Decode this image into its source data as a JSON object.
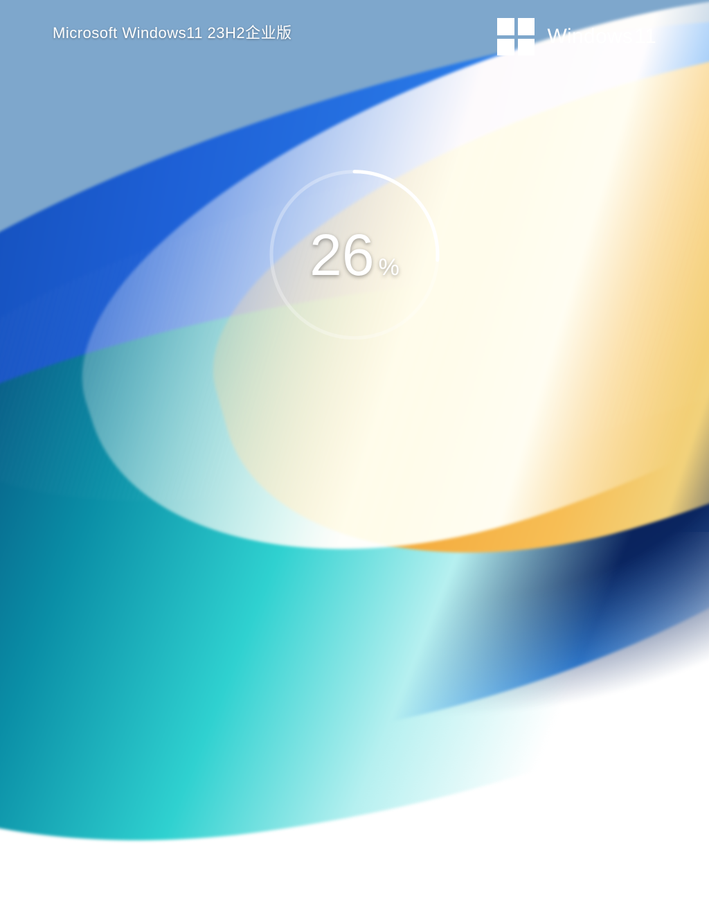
{
  "header": {
    "title": "Microsoft Windows11 23H2企业版",
    "brand_wordmark": "Windows",
    "brand_suffix": "11"
  },
  "progress": {
    "value": 26,
    "display_number": "26",
    "percent_symbol": "%"
  },
  "colors": {
    "text": "#ffffff",
    "sky": "#7ea7cc",
    "deep_blue": "#1e60d6",
    "teal": "#2fd1d0",
    "orange": "#f4a93a"
  }
}
